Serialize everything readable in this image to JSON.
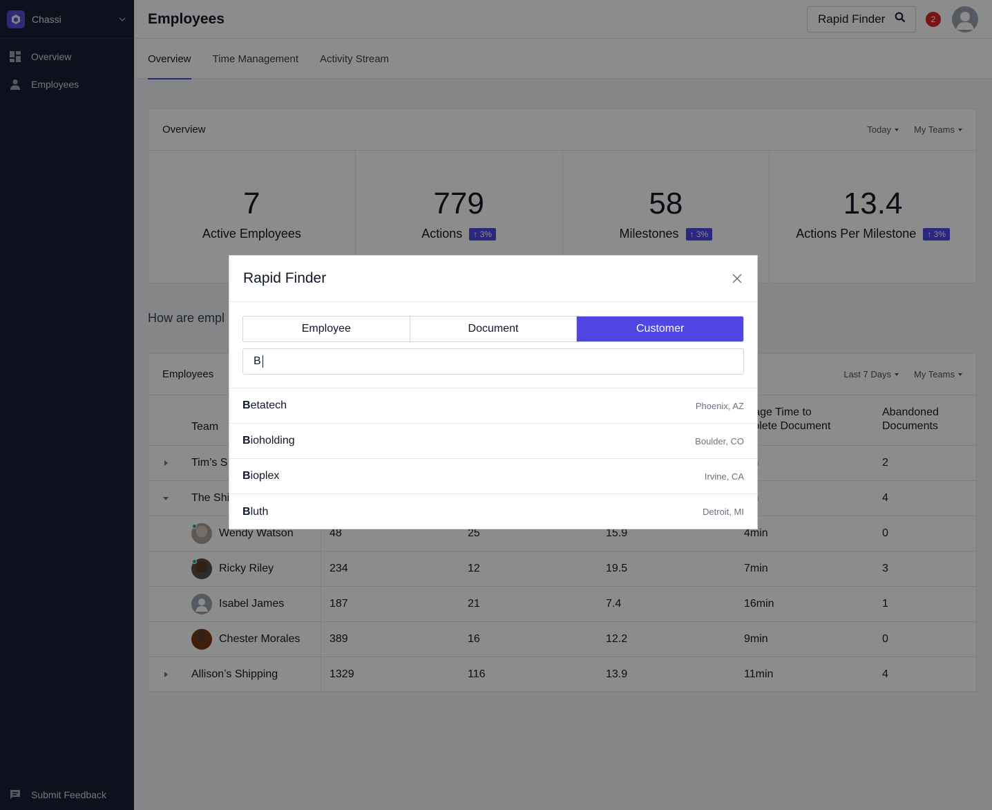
{
  "sidebar": {
    "brand": "Chassi",
    "items": [
      {
        "label": "Overview",
        "icon": "dashboard-icon"
      },
      {
        "label": "Employees",
        "icon": "person-icon"
      }
    ],
    "feedback": "Submit Feedback"
  },
  "header": {
    "title": "Employees",
    "rapid_finder_label": "Rapid Finder",
    "notification_count": "2"
  },
  "tabs": [
    "Overview",
    "Time Management",
    "Activity Stream"
  ],
  "overview": {
    "title": "Overview",
    "filters": [
      "Today",
      "My Teams"
    ],
    "stats": [
      {
        "value": "7",
        "label": "Active Employees",
        "badge": ""
      },
      {
        "value": "779",
        "label": "Actions",
        "badge": "↑ 3%"
      },
      {
        "value": "58",
        "label": "Milestones",
        "badge": "↑ 3%"
      },
      {
        "value": "13.4",
        "label": "Actions Per Milestone",
        "badge": "↑ 3%"
      }
    ]
  },
  "question": "How are empl",
  "employees": {
    "title": "Employees",
    "filters": [
      "Last 7 Days",
      "My Teams"
    ],
    "columns": [
      "Team",
      "",
      "",
      "",
      "erage Time to mplete Document",
      "Abandoned Documents"
    ],
    "col4_line1": "erage Time to",
    "col4_line2": "mplete Document",
    "col5_line1": "Abandoned",
    "col5_line2": "Documents",
    "rows": [
      {
        "type": "team",
        "expanded": false,
        "name": "Tim’s S",
        "c2": "",
        "c3": "",
        "c4": "",
        "c5": "nin",
        "c6": "2"
      },
      {
        "type": "team",
        "expanded": true,
        "name": "The Shi",
        "c2": "",
        "c3": "",
        "c4": "",
        "c5": "nin",
        "c6": "4"
      },
      {
        "type": "member",
        "name": "Wendy Watson",
        "c2": "48",
        "c3": "25",
        "c4": "15.9",
        "c5": "4min",
        "c6": "0"
      },
      {
        "type": "member",
        "name": "Ricky Riley",
        "c2": "234",
        "c3": "12",
        "c4": "19.5",
        "c5": "7min",
        "c6": "3"
      },
      {
        "type": "member",
        "name": "Isabel James",
        "c2": "187",
        "c3": "21",
        "c4": "7.4",
        "c5": "16min",
        "c6": "1"
      },
      {
        "type": "member",
        "name": "Chester Morales",
        "c2": "389",
        "c3": "16",
        "c4": "12.2",
        "c5": "9min",
        "c6": "0"
      },
      {
        "type": "team",
        "expanded": false,
        "name": "Allison’s Shipping",
        "c2": "1329",
        "c3": "116",
        "c4": "13.9",
        "c5": "11min",
        "c6": "4"
      }
    ]
  },
  "modal": {
    "title": "Rapid Finder",
    "segments": [
      "Employee",
      "Document",
      "Customer"
    ],
    "active_segment": "Customer",
    "query": "B",
    "results": [
      {
        "match": "B",
        "rest": "etatech",
        "location": "Phoenix, AZ"
      },
      {
        "match": "B",
        "rest": "ioholding",
        "location": "Boulder, CO"
      },
      {
        "match": "B",
        "rest": "ioplex",
        "location": "Irvine, CA"
      },
      {
        "match": "B",
        "rest": "luth",
        "location": "Detroit, MI"
      }
    ]
  },
  "colors": {
    "accent": "#4f46e5",
    "sidebar": "#1a2036",
    "notification": "#dc2626",
    "online": "#10b981"
  }
}
